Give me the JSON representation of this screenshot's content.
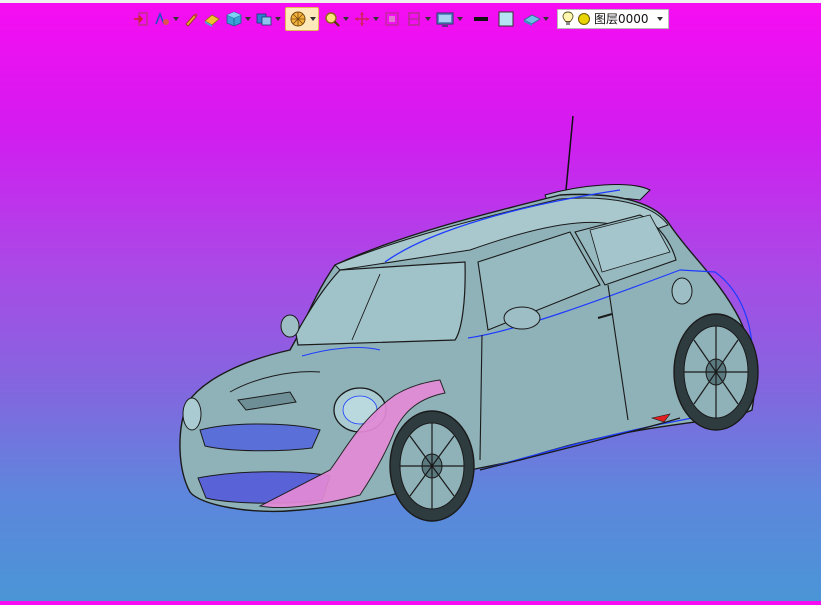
{
  "toolbar": {
    "tools": [
      {
        "name": "exit-sketch-icon",
        "dropdown": false
      },
      {
        "name": "constraint-icon",
        "dropdown": true
      },
      {
        "name": "pen-icon",
        "dropdown": false
      },
      {
        "name": "eraser-icon",
        "dropdown": false
      },
      {
        "name": "view-cube-icon",
        "dropdown": true
      },
      {
        "name": "render-style-icon",
        "dropdown": true
      },
      {
        "name": "wireframe-shading-icon",
        "dropdown": true,
        "active": true
      },
      {
        "name": "zoom-icon",
        "dropdown": true
      },
      {
        "name": "pan-icon",
        "dropdown": true
      },
      {
        "name": "fit-view-icon",
        "dropdown": false
      },
      {
        "name": "section-view-icon",
        "dropdown": true
      },
      {
        "name": "display-settings-icon",
        "dropdown": true
      },
      {
        "name": "line-color-swatch",
        "dropdown": false
      },
      {
        "name": "fill-color-swatch",
        "dropdown": false
      },
      {
        "name": "layer-material-icon",
        "dropdown": true
      }
    ],
    "layer": {
      "label": "图层0000",
      "visible_icon": "lightbulb-icon",
      "color_icon": "layer-color-icon"
    }
  },
  "colors": {
    "background_top": "#f80cf2",
    "background_bottom": "#4a95d6",
    "model_body": "#8fb1b8",
    "edge_line": "#1a1a1a",
    "highlight_edge": "#1e3cff",
    "selected_face": "#e48ad6",
    "layer_color": "#e8d400"
  }
}
